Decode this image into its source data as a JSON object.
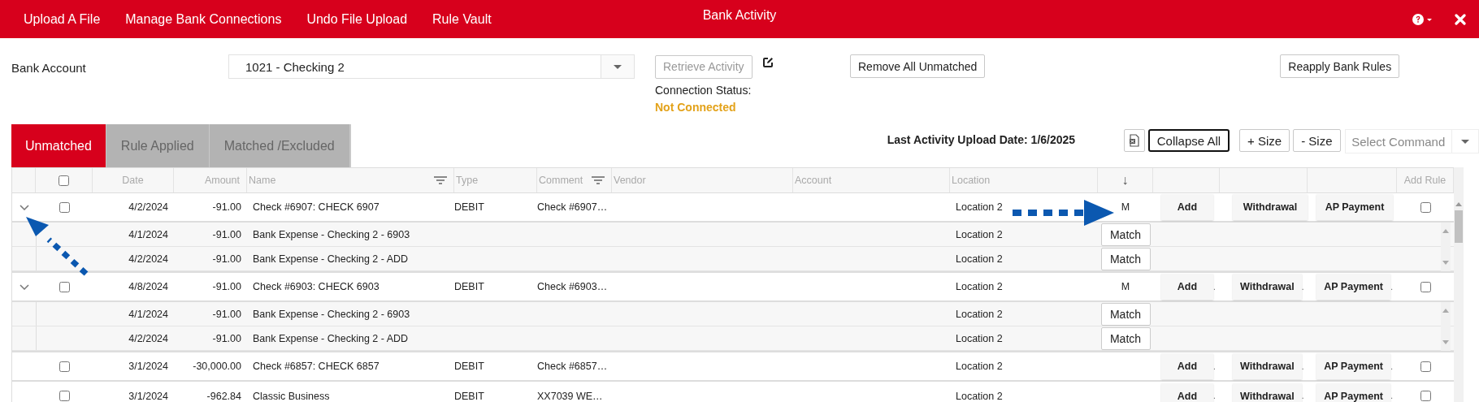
{
  "topbar": {
    "menu": [
      "Upload A File",
      "Manage Bank Connections",
      "Undo File Upload",
      "Rule Vault"
    ],
    "title": "Bank Activity"
  },
  "bank_account": {
    "label": "Bank Account",
    "value": "1021 - Checking 2"
  },
  "retrieve_button": {
    "label": "Retrieve Activity",
    "disabled": true
  },
  "connection": {
    "label": "Connection Status:",
    "status": "Not Connected"
  },
  "remove_button": "Remove All Unmatched",
  "reapply_button": "Reapply Bank Rules",
  "tabs": [
    {
      "label": "Unmatched",
      "selected": true
    },
    {
      "label": "Rule Applied",
      "selected": false
    },
    {
      "label": "Matched /Excluded",
      "selected": false
    }
  ],
  "last_upload": "Last Activity Upload Date: 1/6/2025",
  "grid_buttons": [
    {
      "label": "Collapse All",
      "focused": true
    },
    {
      "label": "+ Size",
      "focused": false
    },
    {
      "label": "- Size",
      "focused": false
    }
  ],
  "command_select": {
    "placeholder": "Select Command"
  },
  "table": {
    "select_all_checked": false,
    "columns": [
      {
        "label": "Date",
        "filter": false
      },
      {
        "label": "Amount",
        "filter": false
      },
      {
        "label": "Name",
        "filter": true
      },
      {
        "label": "Type",
        "filter": false
      },
      {
        "label": "Comment",
        "filter": true
      },
      {
        "label": "Vendor",
        "filter": false
      },
      {
        "label": "Account",
        "filter": false
      },
      {
        "label": "Location",
        "filter": false
      },
      {
        "label": "↓",
        "filter": false
      }
    ],
    "add_rule_column": "Add Rule",
    "rows": [
      {
        "expanded": true,
        "checked": false,
        "date": "4/2/2024",
        "amount": "-91.00",
        "name": "Check #6907: CHECK 6907",
        "type": "DEBIT",
        "comment": "Check #6907…",
        "location": "Location 2",
        "flag": "M",
        "actions": [
          "Add",
          "Withdrawal",
          "AP Payment"
        ],
        "add_rule_checked": false,
        "matches": [
          {
            "date": "4/1/2024",
            "amount": "-91.00",
            "name": "Bank Expense - Checking 2 - 6903",
            "location": "Location 2",
            "button": "Match"
          },
          {
            "date": "4/2/2024",
            "amount": "-91.00",
            "name": "Bank Expense - Checking 2 - ADD",
            "location": "Location 2",
            "button": "Match"
          }
        ]
      },
      {
        "expanded": true,
        "checked": false,
        "date": "4/8/2024",
        "amount": "-91.00",
        "name": "Check #6903: CHECK 6903",
        "type": "DEBIT",
        "comment": "Check #6903…",
        "location": "Location 2",
        "flag": "M",
        "actions": [
          "Add",
          "Withdrawal",
          "AP Payment"
        ],
        "separator": ".",
        "add_rule_checked": false,
        "matches": [
          {
            "date": "4/1/2024",
            "amount": "-91.00",
            "name": "Bank Expense - Checking 2 - 6903",
            "location": "Location 2",
            "button": "Match"
          },
          {
            "date": "4/2/2024",
            "amount": "-91.00",
            "name": "Bank Expense - Checking 2 - ADD",
            "location": "Location 2",
            "button": "Match"
          }
        ]
      },
      {
        "expanded": false,
        "checked": false,
        "date": "3/1/2024",
        "amount": "-30,000.00",
        "name": "Check #6857: CHECK 6857",
        "type": "DEBIT",
        "comment": "Check #6857…",
        "location": "Location 2",
        "actions": [
          "Add",
          "Withdrawal",
          "AP Payment"
        ],
        "separator": ".",
        "add_rule_checked": false,
        "matches": []
      },
      {
        "expanded": false,
        "checked": false,
        "date": "3/1/2024",
        "amount": "-962.84",
        "name": "Classic Business",
        "type": "DEBIT",
        "comment": "XX7039 WE…",
        "location": "Location 2",
        "actions": [
          "Add",
          "Withdrawal",
          "AP Payment"
        ],
        "separator": ".",
        "add_rule_checked": false,
        "matches": []
      }
    ]
  }
}
